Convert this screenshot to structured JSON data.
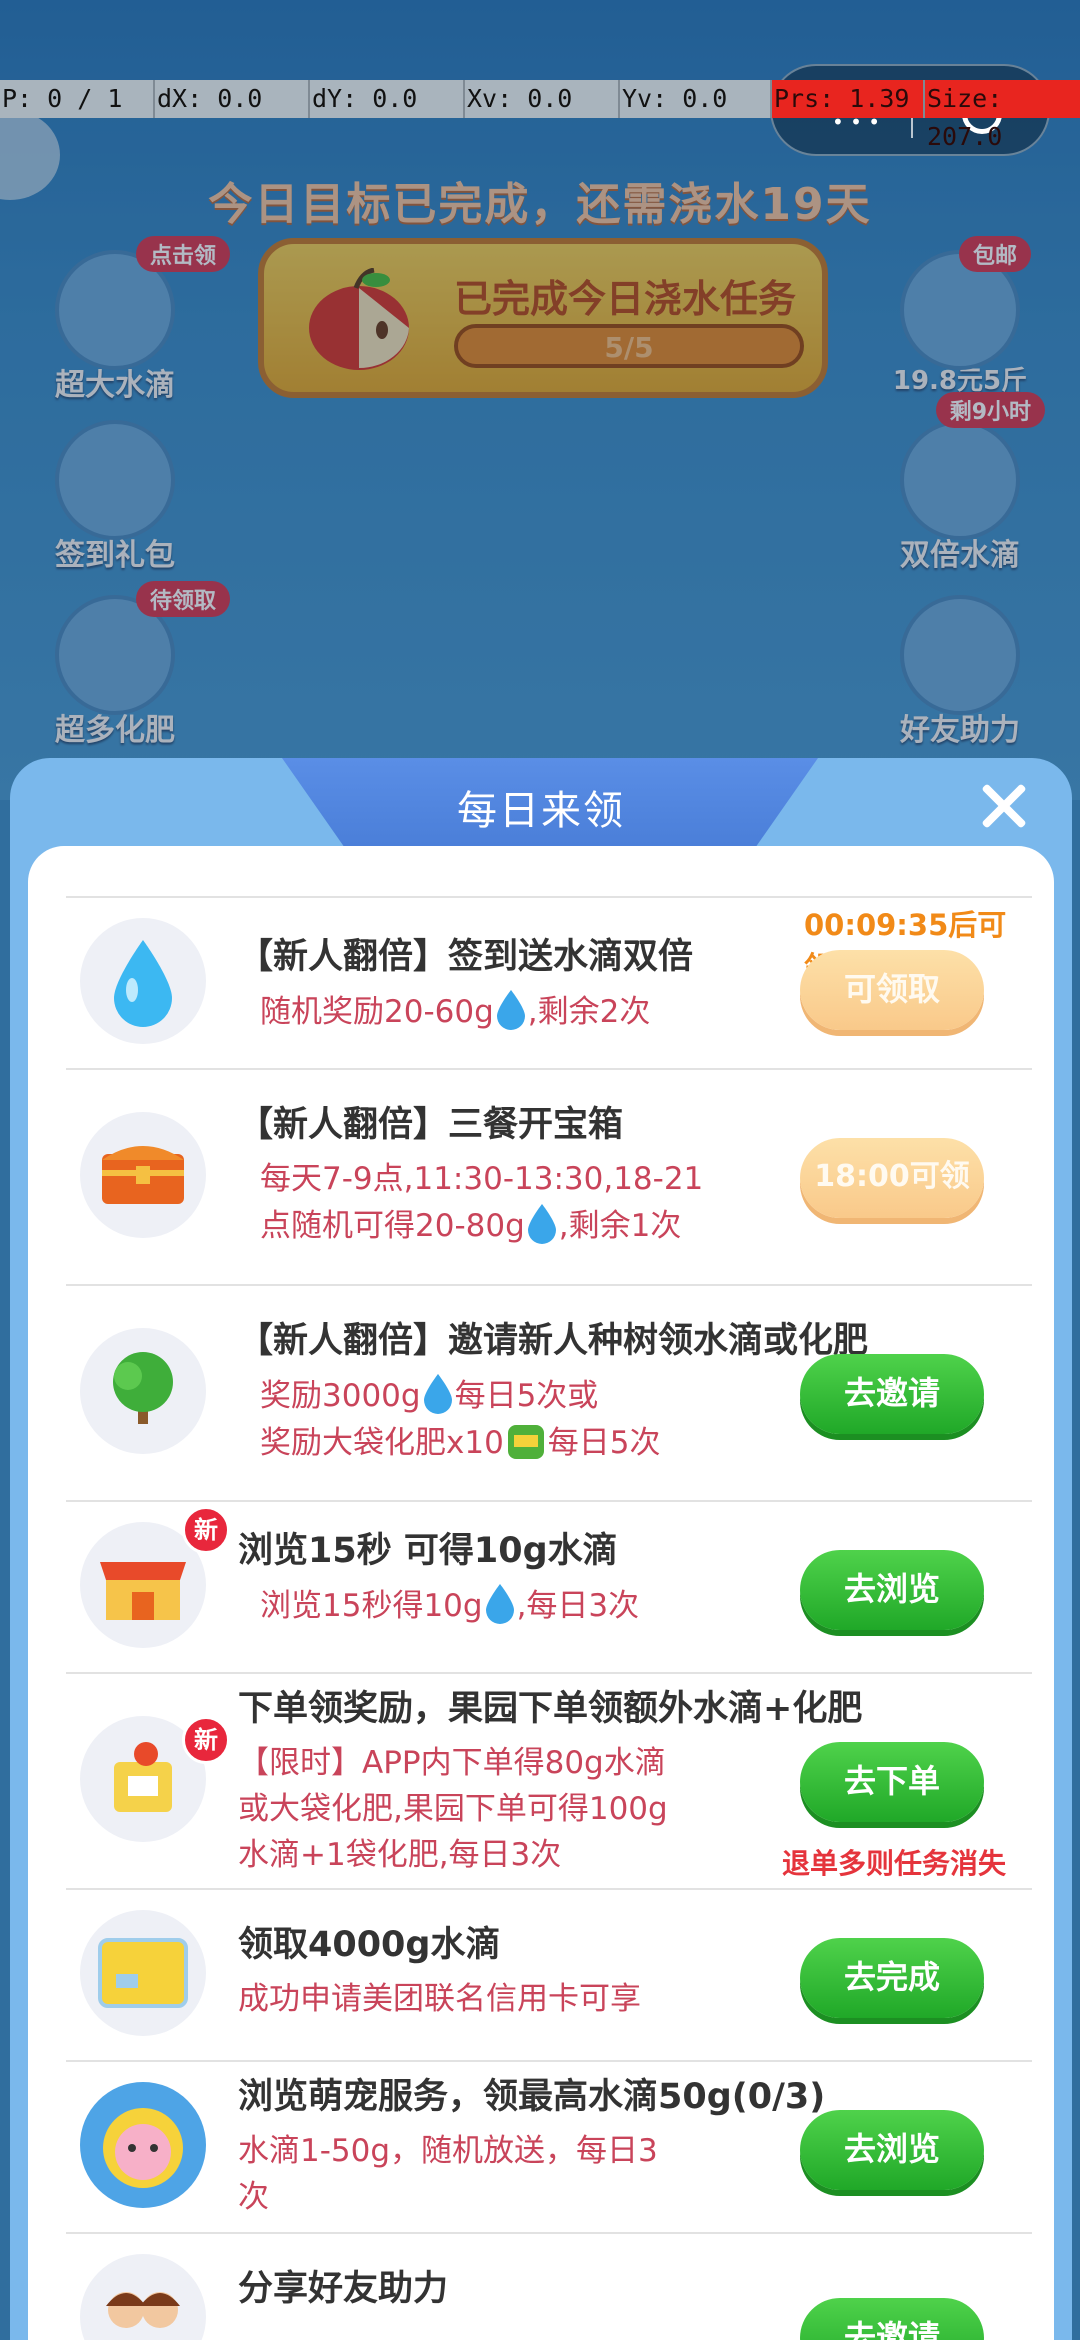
{
  "debug": {
    "p": "P: 0 / 1",
    "dx": "dX: 0.0",
    "dy": "dY: 0.0",
    "xv": "Xv: 0.0",
    "yv": "Yv: 0.0",
    "prs": "Prs: 1.39",
    "size": "Size: 207.0"
  },
  "game": {
    "goal_text": "今日目标已完成，还需浇水19天",
    "goal_card_title": "已完成今日浇水任务",
    "goal_progress": "5/5",
    "goal_progress_fraction": 1.0,
    "left_buttons": [
      {
        "label": "超大水滴",
        "tag": "点击领"
      },
      {
        "label": "签到礼包",
        "tag": ""
      },
      {
        "label": "超多化肥",
        "tag": "待领取"
      }
    ],
    "right_buttons": [
      {
        "label": "19.8元5斤",
        "tag": "包邮"
      },
      {
        "label": "双倍水滴",
        "tag": "剩9小时"
      },
      {
        "label": "好友助力",
        "tag": ""
      }
    ]
  },
  "modal": {
    "title": "每日来领",
    "tasks": [
      {
        "title": "【新人翻倍】签到送水滴双倍",
        "desc": [
          "随机奖励20-60g",
          ",剩余2次"
        ],
        "countdown": "00:09:35后可领",
        "button": "可领取",
        "icon": "water-drop-icon"
      },
      {
        "title": "【新人翻倍】三餐开宝箱",
        "desc": [
          "每天7-9点,11:30-13:30,18-21",
          "点随机可得20-80g",
          ",剩余1次"
        ],
        "button": "18:00可领",
        "icon": "treasure-chest-icon"
      },
      {
        "title": "【新人翻倍】邀请新人种树领水滴或化肥",
        "desc": [
          "奖励3000g",
          "每日5次或",
          "奖励大袋化肥x10",
          "每日5次"
        ],
        "button": "去邀请",
        "icon": "tree-icon"
      },
      {
        "title": "浏览15秒 可得10g水滴",
        "desc": [
          "浏览15秒得10g",
          ",每日3次"
        ],
        "button": "去浏览",
        "badge": "新",
        "icon": "storefront-icon"
      },
      {
        "title": "下单领奖励，果园下单领额外水滴+化肥",
        "desc": [
          "【限时】APP内下单得80g水滴",
          "或大袋化肥,果园下单可得100g",
          "水滴+1袋化肥,每日3次"
        ],
        "button": "去下单",
        "warn": "退单多则任务消失",
        "badge": "新",
        "icon": "takeout-bag-icon"
      },
      {
        "title": "领取4000g水滴",
        "desc": [
          "成功申请美团联名信用卡可享"
        ],
        "button": "去完成",
        "icon": "credit-card-icon"
      },
      {
        "title": "浏览萌宠服务，领最高水滴50g(0/3)",
        "desc": [
          "水滴1-50g，随机放送，每日3",
          "次"
        ],
        "button": "去浏览",
        "icon": "pet-avatar-icon"
      },
      {
        "title": "分享好友助力",
        "desc": [],
        "button": "去邀请",
        "icon": "friends-icon"
      }
    ]
  }
}
